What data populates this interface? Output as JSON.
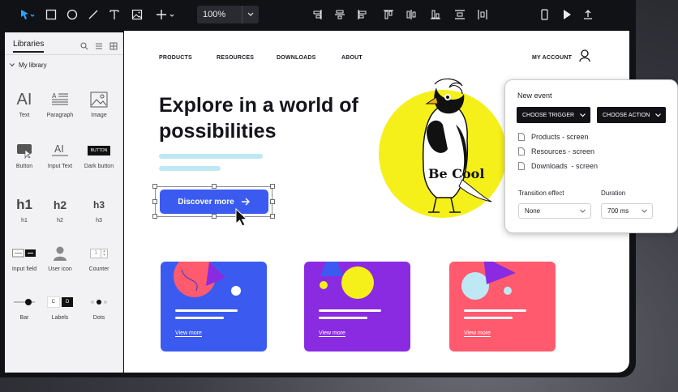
{
  "toolbar": {
    "zoom": "100%",
    "tools": [
      "select-tool",
      "rectangle-tool",
      "ellipse-tool",
      "line-tool",
      "text-tool",
      "image-tool",
      "add-tool"
    ],
    "align_tools": [
      "align-left",
      "align-center-vertical",
      "align-right",
      "align-top",
      "align-middle",
      "align-bottom",
      "distribute-vertical",
      "distribute-horizontal"
    ],
    "right_tools": [
      "mobile-preview",
      "play",
      "export"
    ]
  },
  "sidebar": {
    "title": "Libraries",
    "library_name": "My library",
    "items": [
      {
        "label": "Text",
        "icon": "text-icon"
      },
      {
        "label": "Paragraph",
        "icon": "paragraph-icon"
      },
      {
        "label": "Image",
        "icon": "image-icon"
      },
      {
        "label": "Button",
        "icon": "button-icon"
      },
      {
        "label": "Input Text",
        "icon": "input-text-icon"
      },
      {
        "label": "Dark button",
        "icon": "dark-button-icon",
        "sample": "BUTTON"
      },
      {
        "label": "h1",
        "icon": "h1-icon",
        "sample": "h1"
      },
      {
        "label": "h2",
        "icon": "h2-icon",
        "sample": "h2"
      },
      {
        "label": "h3",
        "icon": "h3-icon",
        "sample": "h3"
      },
      {
        "label": "Input field",
        "icon": "input-field-icon"
      },
      {
        "label": "User icon",
        "icon": "user-icon"
      },
      {
        "label": "Counter",
        "icon": "counter-icon",
        "sample": "1"
      },
      {
        "label": "Bar",
        "icon": "bar-icon"
      },
      {
        "label": "Labels",
        "icon": "labels-icon",
        "sample_a": "C",
        "sample_b": "D"
      },
      {
        "label": "Dots",
        "icon": "dots-icon"
      }
    ]
  },
  "page": {
    "nav": [
      "PRODUCTS",
      "RESOURCES",
      "DOWNLOADS",
      "ABOUT"
    ],
    "account": "MY ACCOUNT",
    "hero_title": "Explore in a world of possibilities",
    "cta": "Discover more",
    "badge_text": "Be Cool",
    "cards": [
      {
        "color": "#3b5bf0",
        "link": "View more"
      },
      {
        "color": "#8a2be2",
        "link": "View more"
      },
      {
        "color": "#ff5a6e",
        "link": "View more"
      }
    ]
  },
  "event_panel": {
    "title": "New event",
    "trigger": "CHOOSE TRIGGER",
    "action": "CHOOSE ACTION",
    "screens": [
      "Products - screen",
      "Resources - screen",
      "Downloads  - screen"
    ],
    "transition_label": "Transition effect",
    "transition_value": "None",
    "duration_label": "Duration",
    "duration_value": "700 ms"
  },
  "colors": {
    "accent": "#3b5bf0",
    "purple": "#8a2be2",
    "coral": "#ff5a6e",
    "yellow": "#f5f01a",
    "dark": "#121217"
  }
}
